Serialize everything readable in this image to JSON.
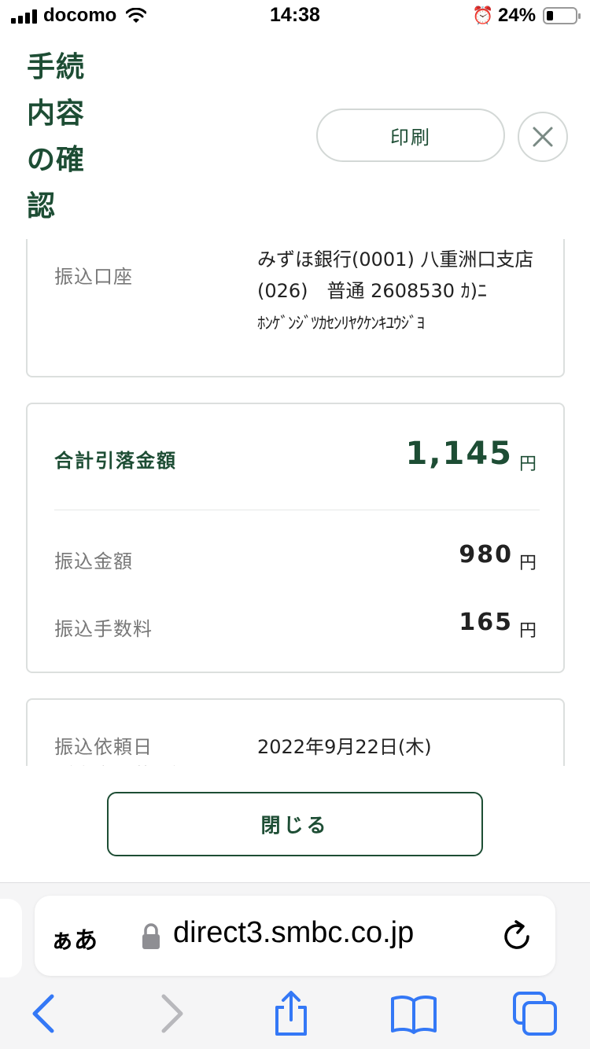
{
  "status_bar": {
    "carrier": "docomo",
    "time": "14:38",
    "battery": "24%",
    "battery_level": 0.24
  },
  "header": {
    "title": "手続内容の確認",
    "print_label": "印刷"
  },
  "account": {
    "label": "振込口座",
    "value": "みずほ銀行(0001) 八重洲口支店　(026)　普通 2608530 ｶ)ﾆ",
    "kana": "ﾎﾝｹﾞﾝｼﾞﾂｶｾﾝﾘﾔｸｹﾝｷﾕｳｼﾞﾖ"
  },
  "totals": {
    "total_label": "合計引落金額",
    "total_amount": "1,145",
    "currency": "円",
    "rows": [
      {
        "label": "振込金額",
        "amount": "980"
      },
      {
        "label": "振込手数料",
        "amount": "165"
      }
    ]
  },
  "request": {
    "label": "振込依頼日",
    "label_sub": "（資金引落日）",
    "value": "2022年9月22日(木)"
  },
  "actions": {
    "close_label": "閉じる"
  },
  "safari": {
    "aa_label": "ぁあ",
    "url": "direct3.smbc.co.jp"
  },
  "colors": {
    "accent": "#1d4d34",
    "ios_blue": "#3478f6"
  }
}
